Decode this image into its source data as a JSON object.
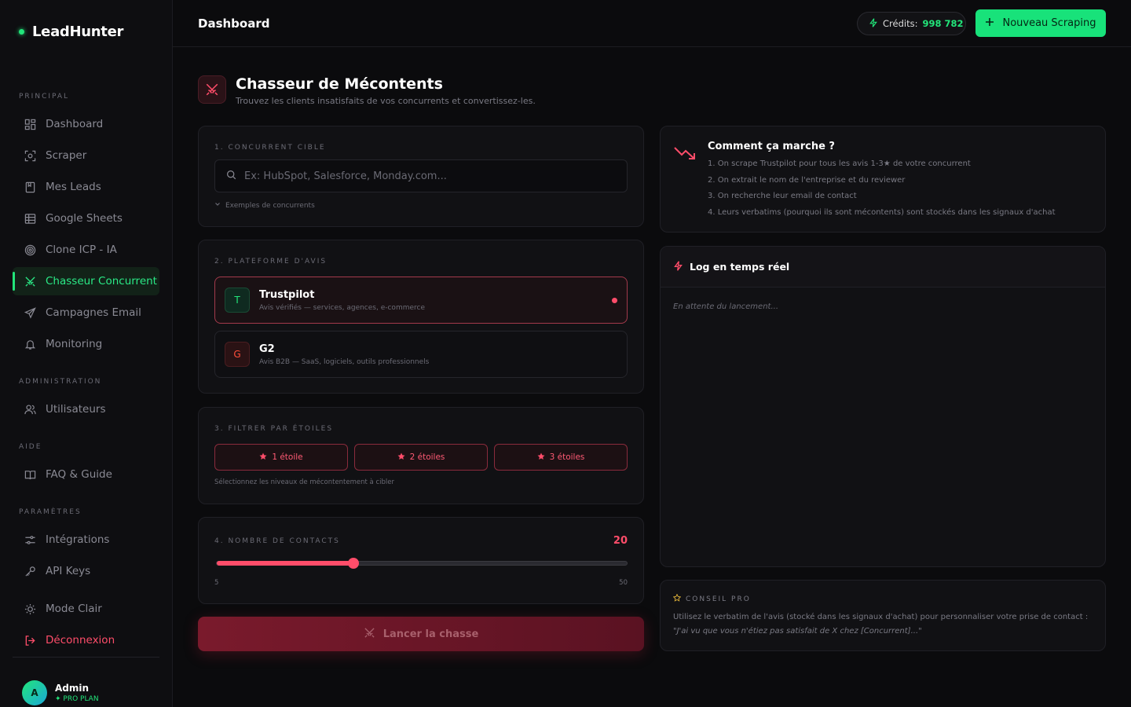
{
  "app": {
    "name": "LeadHunter"
  },
  "sidebar": {
    "sections": {
      "principal": "PRINCIPAL",
      "administration": "ADMINISTRATION",
      "aide": "AIDE",
      "parametres": "PARAMÈTRES"
    },
    "items": {
      "dashboard": "Dashboard",
      "scraper": "Scraper",
      "mes_leads": "Mes Leads",
      "google_sheets": "Google Sheets",
      "clone_icp": "Clone ICP - IA",
      "chasseur": "Chasseur Concurrent",
      "campagnes": "Campagnes Email",
      "monitoring": "Monitoring",
      "utilisateurs": "Utilisateurs",
      "faq": "FAQ & Guide",
      "integrations": "Intégrations",
      "api_keys": "API Keys",
      "mode_clair": "Mode Clair",
      "deconnexion": "Déconnexion"
    },
    "user": {
      "initial": "A",
      "name": "Admin",
      "plan": "✦ PRO PLAN"
    }
  },
  "header": {
    "title": "Dashboard",
    "credits_label": "Crédits:",
    "credits_value": "998 782",
    "new_button": "Nouveau Scraping"
  },
  "page": {
    "title": "Chasseur de Mécontents",
    "subtitle": "Trouvez les clients insatisfaits de vos concurrents et convertissez-les."
  },
  "step1": {
    "label": "1. CONCURRENT CIBLE",
    "placeholder": "Ex: HubSpot, Salesforce, Monday.com...",
    "examples": "Exemples de concurrents"
  },
  "step2": {
    "label": "2. PLATEFORME D'AVIS",
    "platforms": [
      {
        "badge": "T",
        "name": "Trustpilot",
        "desc": "Avis vérifiés — services, agences, e-commerce"
      },
      {
        "badge": "G",
        "name": "G2",
        "desc": "Avis B2B — SaaS, logiciels, outils professionnels"
      }
    ]
  },
  "step3": {
    "label": "3. FILTRER PAR ÉTOILES",
    "options": [
      "1 étoile",
      "2 étoiles",
      "3 étoiles"
    ],
    "hint": "Sélectionnez les niveaux de mécontentement à cibler"
  },
  "step4": {
    "label": "4. NOMBRE DE CONTACTS",
    "value": "20",
    "min": "5",
    "max": "50",
    "fraction": 0.333
  },
  "launch_button": "Lancer la chasse",
  "how": {
    "title": "Comment ça marche ?",
    "steps": [
      "1. On scrape Trustpilot pour tous les avis 1-3★ de votre concurrent",
      "2. On extrait le nom de l'entreprise et du reviewer",
      "3. On recherche leur email de contact",
      "4. Leurs verbatims (pourquoi ils sont mécontents) sont stockés dans les signaux d'achat"
    ]
  },
  "log": {
    "title": "Log en temps réel",
    "waiting": "En attente du lancement..."
  },
  "tip": {
    "label": "CONSEIL PRO",
    "text": "Utilisez le verbatim de l'avis (stocké dans les signaux d'achat) pour personnaliser votre prise de contact :",
    "quote": "\"J'ai vu que vous n'étiez pas satisfait de X chez [Concurrent]...\""
  },
  "colors": {
    "accent_green": "#22e57a",
    "accent_red": "#ff4d6a"
  }
}
